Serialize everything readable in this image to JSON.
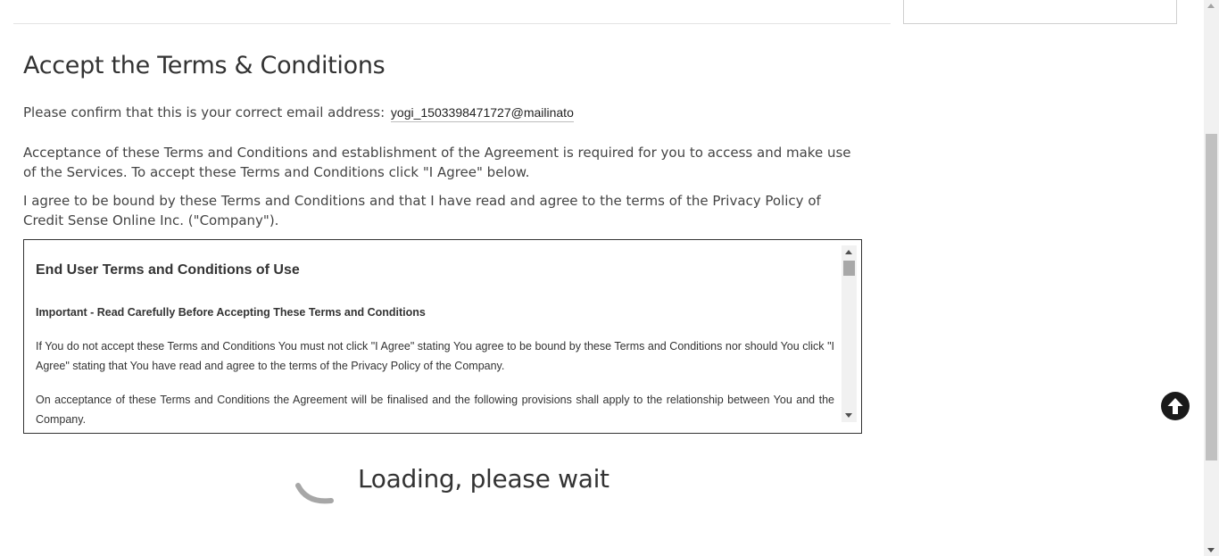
{
  "page_title": "Accept the Terms & Conditions",
  "confirm": {
    "label": "Please confirm that this is your correct email address:",
    "email_value": "yogi_1503398471727@mailinator.com"
  },
  "paragraphs": [
    "Acceptance of these Terms and Conditions and establishment of the Agreement is required for you to access and make use of the Services. To accept these Terms and Conditions click \"I Agree\" below.",
    "I agree to be bound by these Terms and Conditions and that I have read and agree to the terms of the Privacy Policy of Credit Sense Online Inc. (\"Company\")."
  ],
  "terms": {
    "heading": "End User Terms and Conditions of Use",
    "subheading": "Important - Read Carefully Before Accepting These Terms and Conditions",
    "paragraphs": [
      "If You do not accept these Terms and Conditions You must not click \"I Agree\" stating You agree to be bound by these Terms and Conditions nor should You click \"I Agree\" stating that You have read and agree to the terms of the Privacy Policy of the Company.",
      "On acceptance of these Terms and Conditions the Agreement will be finalised and the following provisions shall apply to the relationship between You and the Company."
    ]
  },
  "loading": {
    "text": "Loading, please wait",
    "spinner_icon": "spinner-icon"
  },
  "scroll_top": {
    "icon": "arrow-up-circle-icon"
  }
}
